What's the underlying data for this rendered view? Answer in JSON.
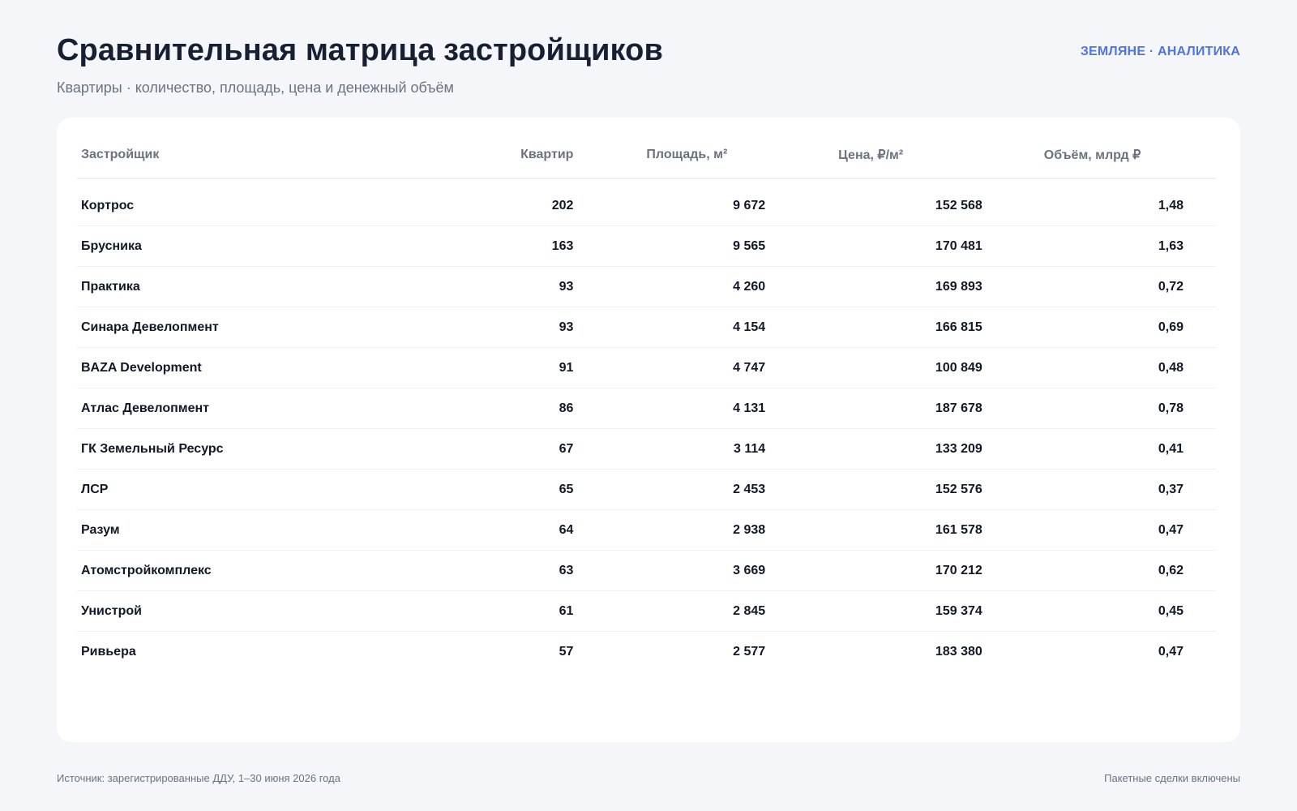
{
  "header": {
    "title": "Сравнительная матрица застройщиков",
    "subtitle": "Квартиры · количество, площадь, цена и денежный объём",
    "brand": "ЗЕМЛЯНЕ · АНАЛИТИКА"
  },
  "table": {
    "columns": {
      "developer": "Застройщик",
      "flats": "Квартир",
      "area": "Площадь, м²",
      "price": "Цена, ₽/м²",
      "volume": "Объём, млрд ₽"
    },
    "rows": [
      {
        "developer": "Кортрос",
        "flats": "202",
        "area": "9 672",
        "price": "152 568",
        "volume": "1,48"
      },
      {
        "developer": "Брусника",
        "flats": "163",
        "area": "9 565",
        "price": "170 481",
        "volume": "1,63"
      },
      {
        "developer": "Практика",
        "flats": "93",
        "area": "4 260",
        "price": "169 893",
        "volume": "0,72"
      },
      {
        "developer": "Синара Девелопмент",
        "flats": "93",
        "area": "4 154",
        "price": "166 815",
        "volume": "0,69"
      },
      {
        "developer": "BAZA Development",
        "flats": "91",
        "area": "4 747",
        "price": "100 849",
        "volume": "0,48"
      },
      {
        "developer": "Атлас Девелопмент",
        "flats": "86",
        "area": "4 131",
        "price": "187 678",
        "volume": "0,78"
      },
      {
        "developer": "ГК Земельный Ресурс",
        "flats": "67",
        "area": "3 114",
        "price": "133 209",
        "volume": "0,41"
      },
      {
        "developer": "ЛСР",
        "flats": "65",
        "area": "2 453",
        "price": "152 576",
        "volume": "0,37"
      },
      {
        "developer": "Разум",
        "flats": "64",
        "area": "2 938",
        "price": "161 578",
        "volume": "0,47"
      },
      {
        "developer": "Атомстройкомплекс",
        "flats": "63",
        "area": "3 669",
        "price": "170 212",
        "volume": "0,62"
      },
      {
        "developer": "Унистрой",
        "flats": "61",
        "area": "2 845",
        "price": "159 374",
        "volume": "0,45"
      },
      {
        "developer": "Ривьера",
        "flats": "57",
        "area": "2 577",
        "price": "183 380",
        "volume": "0,47"
      }
    ]
  },
  "footer": {
    "source": "Источник: зарегистрированные ДДУ, 1–30 июня 2026 года",
    "note": "Пакетные сделки включены"
  },
  "colors": {
    "background": "#f4f6f9",
    "card": "#ffffff",
    "title": "#172033",
    "muted": "#6b7280",
    "accent": "#4f74e3"
  }
}
